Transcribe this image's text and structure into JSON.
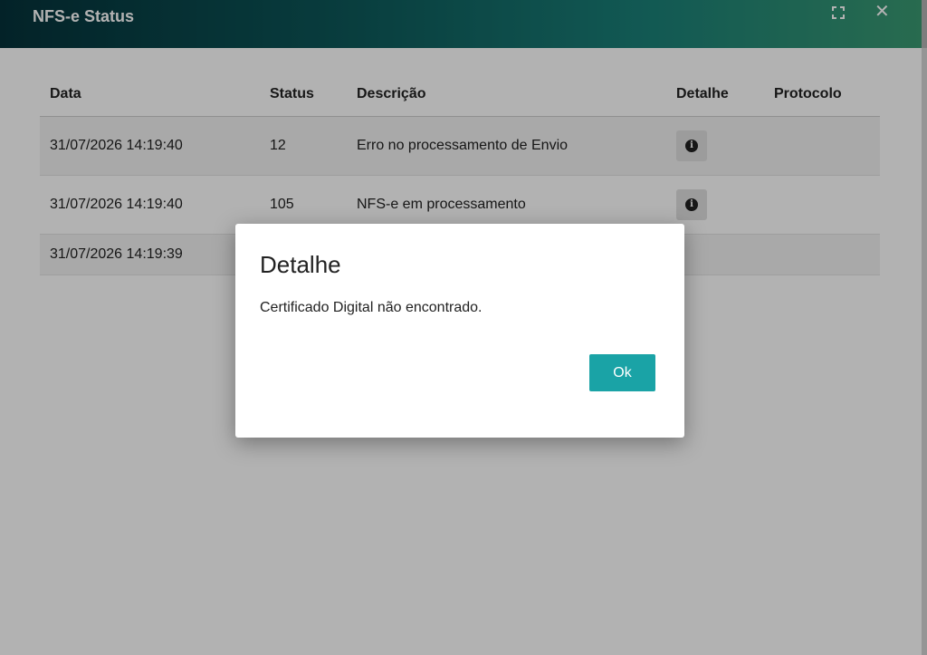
{
  "window": {
    "title": "NFS-e Status",
    "maximize_icon": "⛶",
    "close_icon": "✕"
  },
  "table": {
    "headers": [
      "Data",
      "Status",
      "Descrição",
      "Detalhe",
      "Protocolo"
    ],
    "rows": [
      {
        "data": "31/07/2026 14:19:40",
        "status": "12",
        "descricao": "Erro no processamento de Envio",
        "has_detail": true,
        "protocolo": ""
      },
      {
        "data": "31/07/2026 14:19:40",
        "status": "105",
        "descricao": "NFS-e em processamento",
        "has_detail": true,
        "protocolo": ""
      },
      {
        "data": "31/07/2026 14:19:39",
        "status": "",
        "descricao": "",
        "has_detail": false,
        "protocolo": ""
      }
    ]
  },
  "dialog": {
    "title": "Detalhe",
    "message": "Certificado Digital não encontrado.",
    "ok_label": "Ok"
  },
  "colors": {
    "accent": "#1aa3a6",
    "titlebar_start": "#05323a",
    "titlebar_end": "#3a9a72"
  }
}
